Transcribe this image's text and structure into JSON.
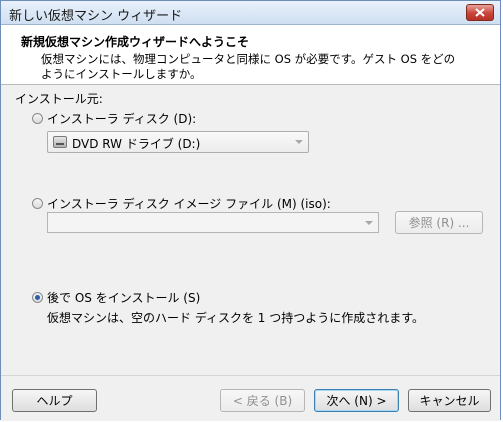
{
  "window": {
    "title": "新しい仮想マシン ウィザード"
  },
  "header": {
    "title": "新規仮想マシン作成ウィザードへようこそ",
    "description": "仮想マシンには、物理コンピュータと同様に OS が必要です。ゲスト OS をどのようにインストールしますか。"
  },
  "install_source": {
    "label": "インストール元:",
    "disc_option": {
      "label": "インストーラ ディスク (D):",
      "selected_drive": "DVD RW ドライブ (D:)",
      "checked": false
    },
    "iso_option": {
      "label": "インストーラ ディスク イメージ ファイル (M) (iso):",
      "value": "",
      "browse_label": "参照 (R) ...",
      "checked": false
    },
    "later_option": {
      "label": "後で OS をインストール (S)",
      "description": "仮想マシンは、空のハード ディスクを 1 つ持つように作成されます。",
      "checked": true
    }
  },
  "footer": {
    "help": "ヘルプ",
    "back": "< 戻る (B)",
    "next": "次へ (N) >",
    "cancel": "キャンセル"
  },
  "colors": {
    "accent": "#2b5fa8",
    "close_button": "#c9453a"
  }
}
